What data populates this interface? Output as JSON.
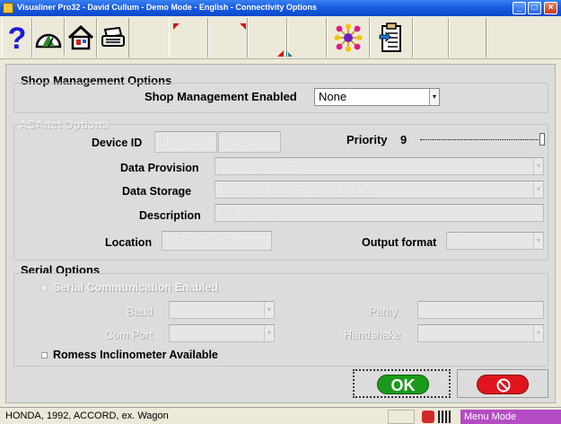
{
  "window": {
    "title": "Visualiner Pro32 - David Cullum - Demo Mode - English - Connectivity Options"
  },
  "toolbar": {
    "buttons": [
      {
        "icon": "help-icon"
      },
      {
        "icon": "gauge-icon"
      },
      {
        "icon": "home-icon"
      },
      {
        "icon": "printer-icon"
      },
      {
        "icon": "flag-marker-icon"
      },
      {
        "icon": "flag-marker-icon"
      },
      {
        "icon": "split-marker-icon"
      },
      {
        "icon": "connectivity-icon"
      },
      {
        "icon": "clipboard-import-icon"
      }
    ]
  },
  "shop": {
    "legend": "Shop Management Options",
    "enabled_label": "Shop Management Enabled",
    "enabled_value": "None"
  },
  "asanet": {
    "legend": "ASAnet Options",
    "device_id_label": "Device ID",
    "device_id_prefix": "SNAPN",
    "device_id_number": "00000",
    "priority_label": "Priority",
    "priority_value": "9",
    "data_provision_label": "Data Provision",
    "data_provision_value": "1-Data generated",
    "data_storage_label": "Data Storage",
    "data_storage_value": "1-Data with same DID not stored",
    "description_label": "Description",
    "description_value": "Snap-on Aligner",
    "location_label": "Location",
    "location_value": "SNAPON0001",
    "output_format_label": "Output format",
    "output_format_value": "XML"
  },
  "serial": {
    "legend": "Serial Options",
    "serial_enabled_label": "Serial Communication Enabled",
    "baud_label": "Baud",
    "baud_value": "",
    "com_port_label": "Com Port",
    "com_port_value": "",
    "parity_label": "Parity",
    "parity_value": "",
    "handshake_label": "Handshake",
    "handshake_value": "",
    "romess_label": "Romess Inclinometer Available"
  },
  "buttons": {
    "ok_label": "OK"
  },
  "status": {
    "vehicle": "HONDA, 1992, ACCORD, ex. Wagon",
    "mode": "Menu Mode"
  },
  "colors": {
    "ok_green": "#1a9a1a",
    "cancel_red": "#e0141e",
    "mode_purple": "#b44cc4",
    "titlebar_blue": "#1b5ee6"
  }
}
